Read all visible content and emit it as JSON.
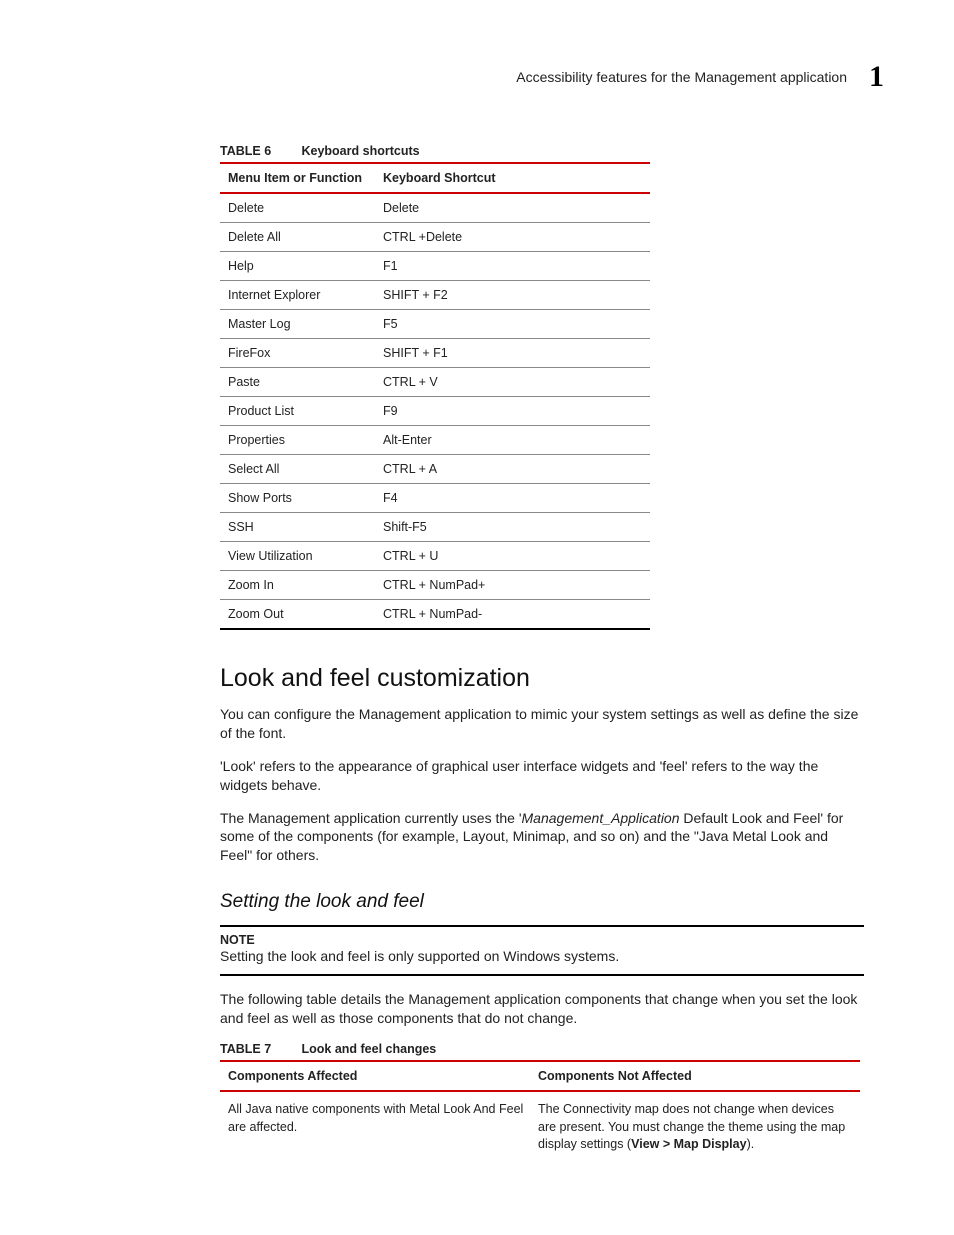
{
  "header": {
    "title": "Accessibility features for the Management application",
    "chapter_number": "1"
  },
  "table6": {
    "label": "TABLE 6",
    "title": "Keyboard shortcuts",
    "col1_header": "Menu Item or Function",
    "col2_header": "Keyboard Shortcut",
    "rows": [
      {
        "fn": "Delete",
        "sc": "Delete"
      },
      {
        "fn": "Delete All",
        "sc": "CTRL +Delete"
      },
      {
        "fn": "Help",
        "sc": "F1"
      },
      {
        "fn": "Internet Explorer",
        "sc": "SHIFT + F2"
      },
      {
        "fn": "Master Log",
        "sc": "F5"
      },
      {
        "fn": "FireFox",
        "sc": "SHIFT + F1"
      },
      {
        "fn": "Paste",
        "sc": "CTRL + V"
      },
      {
        "fn": "Product List",
        "sc": "F9"
      },
      {
        "fn": "Properties",
        "sc": "Alt-Enter"
      },
      {
        "fn": "Select All",
        "sc": "CTRL + A"
      },
      {
        "fn": "Show Ports",
        "sc": "F4"
      },
      {
        "fn": "SSH",
        "sc": "Shift-F5"
      },
      {
        "fn": "View Utilization",
        "sc": "CTRL + U"
      },
      {
        "fn": "Zoom In",
        "sc": "CTRL + NumPad+"
      },
      {
        "fn": "Zoom Out",
        "sc": "CTRL + NumPad-"
      }
    ]
  },
  "look_and_feel": {
    "heading": "Look and feel customization",
    "para1": "You can configure the Management application to mimic your system settings as well as define the size of the font.",
    "para2": "'Look' refers to the appearance of graphical user interface widgets and 'feel' refers to the way the widgets behave.",
    "para3_a": "The Management application currently uses the '",
    "para3_em": "Management_Application",
    "para3_b": " Default Look and Feel' for some of the components (for example, Layout, Minimap, and so on) and the \"Java Metal Look and Feel\" for others.",
    "sub_heading": "Setting the look and feel",
    "note_label": "NOTE",
    "note_text": "Setting the look and feel is only supported on Windows systems.",
    "para4": "The following table details the Management application components that change when you set the look and feel as well as those components that do not change."
  },
  "table7": {
    "label": "TABLE 7",
    "title": "Look and feel changes",
    "col1_header": "Components Affected",
    "col2_header": "Components Not Affected",
    "row1_col1": "All Java native components with Metal Look And Feel are affected.",
    "row1_col2_a": "The Connectivity map does not change when devices are present. You must change the theme using the map display settings (",
    "row1_col2_bold": "View > Map Display",
    "row1_col2_b": ")."
  }
}
